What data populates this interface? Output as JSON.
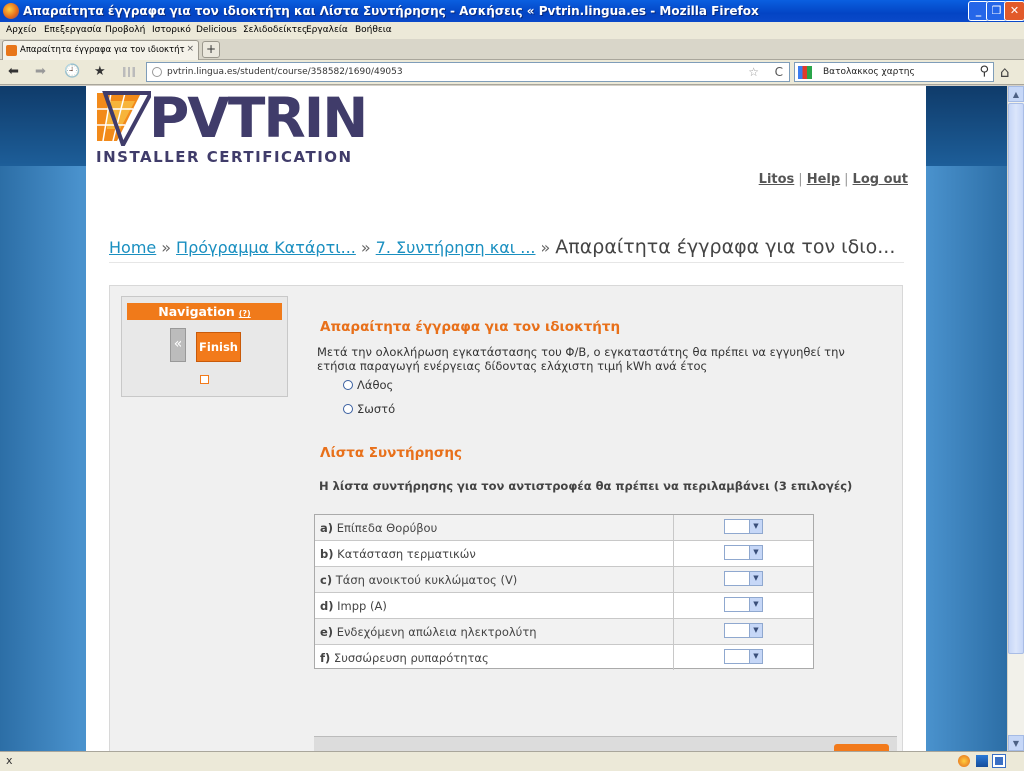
{
  "window": {
    "title": "Απαραίτητα έγγραφα για τον ιδιοκτήτη και Λίστα Συντήρησης - Ασκήσεις « Pvtrin.lingua.es - Mozilla Firefox",
    "minimize": "_",
    "maximize": "❐",
    "close": "✕"
  },
  "menubar": [
    "Αρχείο",
    "Επεξεργασία",
    "Προβολή",
    "Ιστορικό",
    "Delicious",
    "Σελιδοδείκτες",
    "Εργαλεία",
    "Βοήθεια"
  ],
  "tab": {
    "label": "Απαραίτητα έγγραφα για τον ιδιοκτήτη και Λί...",
    "close": "×",
    "new": "+"
  },
  "navbar": {
    "url": "pvtrin.lingua.es/student/course/358582/1690/49053",
    "search": "Βατολακκος χαρτης",
    "back": "⬅",
    "forward": "➡",
    "history": "🕘",
    "bookmarks": "★",
    "star": "☆",
    "reload": "C",
    "home": "⌂",
    "search_icon": "⚲"
  },
  "site": {
    "logo_text": "PVTRIN",
    "logo_sub": "INSTALLER CERTIFICATION",
    "user_links": [
      "Litos",
      "Help",
      "Log out"
    ]
  },
  "breadcrumb": {
    "items": [
      "Home",
      "Πρόγραμμα Κατάρτι...",
      "7. Συντήρηση και ..."
    ],
    "current": "Απαραίτητα έγγραφα για τον ιδιο...",
    "separator": "»"
  },
  "navigation": {
    "header": "Navigation",
    "help": "(?)",
    "prev": "«",
    "finish": "Finish"
  },
  "question1": {
    "title": "Απαραίτητα έγγραφα για τον ιδιοκτήτη",
    "text": "Μετά την ολοκλήρωση εγκατάστασης του Φ/Β, ο εγκαταστάτης θα πρέπει να εγγυηθεί την ετήσια παραγωγή ενέργειας δίδοντας ελάχιστη τιμή kWh ανά έτος",
    "options": [
      "Λάθος",
      "Σωστό"
    ]
  },
  "question2": {
    "title": "Λίστα Συντήρησης",
    "prompt": "Η λίστα συντήρησης για τον αντιστροφέα θα πρέπει να περιλαμβάνει (3 επιλογές)",
    "rows": [
      {
        "letter": "a)",
        "label": "Επίπεδα Θορύβου"
      },
      {
        "letter": "b)",
        "label": "Κατάσταση τερματικών"
      },
      {
        "letter": "c)",
        "label": "Τάση ανοικτού κυκλώματος (V)"
      },
      {
        "letter": "d)",
        "label": "Impp (A)"
      },
      {
        "letter": "e)",
        "label": "Ενδεχόμενη απώλεια ηλεκτρολύτη"
      },
      {
        "letter": "f)",
        "label": "Συσσώρευση ρυπαρότητας"
      }
    ],
    "dropdown_arrow": "▼"
  },
  "statusbar": {
    "close": "x"
  },
  "colors": {
    "accent": "#f27a1b",
    "link": "#1a8fc0",
    "logo": "#403c6a"
  }
}
